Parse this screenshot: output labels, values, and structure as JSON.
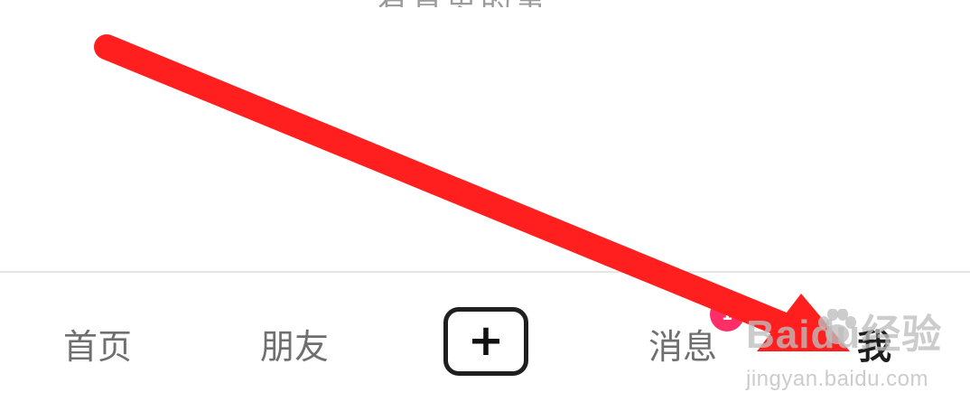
{
  "top_partial_text": "有意思的事",
  "bottom_nav": {
    "items": [
      {
        "label": "首页"
      },
      {
        "label": "朋友"
      },
      {
        "label": "消息"
      },
      {
        "label": "我"
      }
    ],
    "plus_symbol": "+"
  },
  "badges": {
    "messages_badge_text": "1"
  },
  "watermark": {
    "main": "Baidu经验",
    "sub": "jingyan.baidu.com"
  },
  "colors": {
    "arrow": "#ff1f1f",
    "badge": "#ff2d68",
    "active_nav_text": "#1d1d1d",
    "inactive_nav_text": "#6f6f6f"
  },
  "icons": {
    "plus": "plus-icon",
    "arrow": "red-arrow-annotation",
    "watermark_logo": "baidu-paw-icon"
  }
}
